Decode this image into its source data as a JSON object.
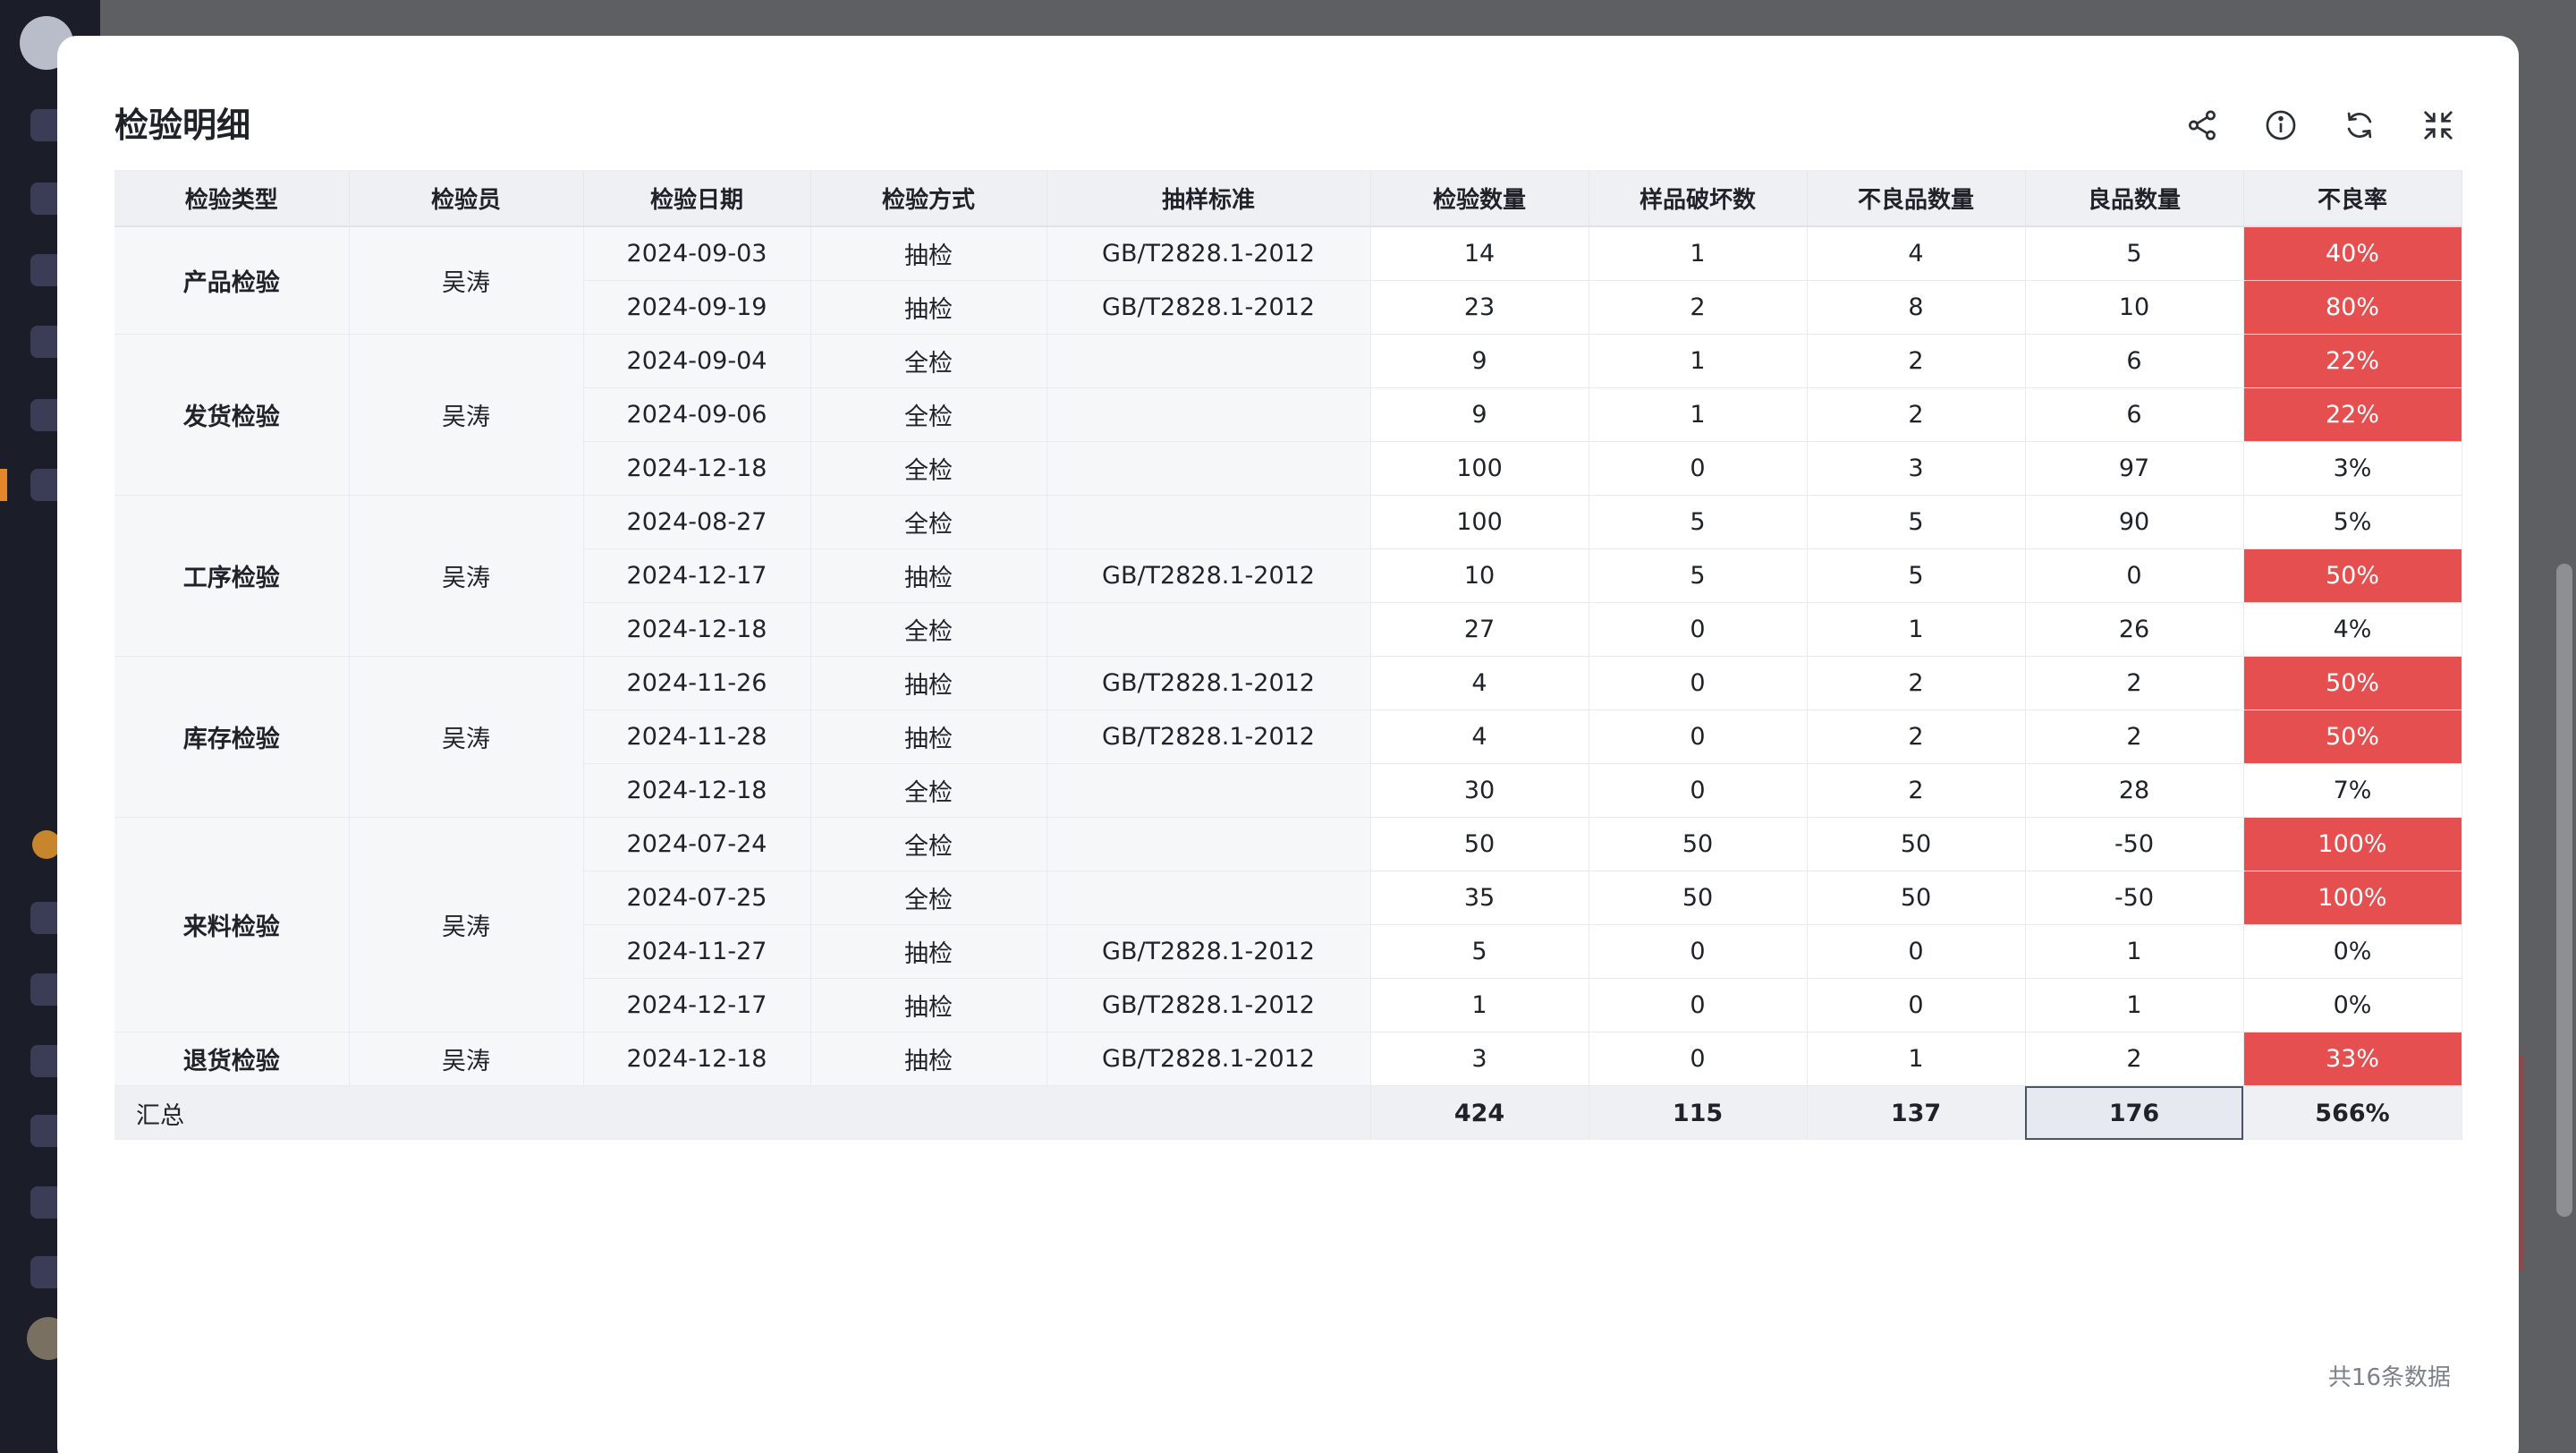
{
  "modal": {
    "title": "检验明细",
    "footer_count": "共16条数据"
  },
  "toolbar": {
    "icons": [
      "share-icon",
      "info-icon",
      "refresh-icon",
      "collapse-icon"
    ]
  },
  "colors": {
    "bad_rate_bg": "#e64f4f",
    "header_bg": "#eef0f4"
  },
  "table": {
    "headers": [
      "检验类型",
      "检验员",
      "检验日期",
      "检验方式",
      "抽样标准",
      "检验数量",
      "样品破坏数",
      "不良品数量",
      "良品数量",
      "不良率"
    ],
    "groups": [
      {
        "type": "产品检验",
        "inspector": "吴涛",
        "rows": [
          {
            "date": "2024-09-03",
            "method": "抽检",
            "standard": "GB/T2828.1-2012",
            "qty": "14",
            "destroyed": "1",
            "defective": "4",
            "good": "5",
            "rate": "40%",
            "bad": true
          },
          {
            "date": "2024-09-19",
            "method": "抽检",
            "standard": "GB/T2828.1-2012",
            "qty": "23",
            "destroyed": "2",
            "defective": "8",
            "good": "10",
            "rate": "80%",
            "bad": true
          }
        ]
      },
      {
        "type": "发货检验",
        "inspector": "吴涛",
        "rows": [
          {
            "date": "2024-09-04",
            "method": "全检",
            "standard": "",
            "qty": "9",
            "destroyed": "1",
            "defective": "2",
            "good": "6",
            "rate": "22%",
            "bad": true
          },
          {
            "date": "2024-09-06",
            "method": "全检",
            "standard": "",
            "qty": "9",
            "destroyed": "1",
            "defective": "2",
            "good": "6",
            "rate": "22%",
            "bad": true
          },
          {
            "date": "2024-12-18",
            "method": "全检",
            "standard": "",
            "qty": "100",
            "destroyed": "0",
            "defective": "3",
            "good": "97",
            "rate": "3%",
            "bad": false
          }
        ]
      },
      {
        "type": "工序检验",
        "inspector": "吴涛",
        "rows": [
          {
            "date": "2024-08-27",
            "method": "全检",
            "standard": "",
            "qty": "100",
            "destroyed": "5",
            "defective": "5",
            "good": "90",
            "rate": "5%",
            "bad": false
          },
          {
            "date": "2024-12-17",
            "method": "抽检",
            "standard": "GB/T2828.1-2012",
            "qty": "10",
            "destroyed": "5",
            "defective": "5",
            "good": "0",
            "rate": "50%",
            "bad": true
          },
          {
            "date": "2024-12-18",
            "method": "全检",
            "standard": "",
            "qty": "27",
            "destroyed": "0",
            "defective": "1",
            "good": "26",
            "rate": "4%",
            "bad": false
          }
        ]
      },
      {
        "type": "库存检验",
        "inspector": "吴涛",
        "rows": [
          {
            "date": "2024-11-26",
            "method": "抽检",
            "standard": "GB/T2828.1-2012",
            "qty": "4",
            "destroyed": "0",
            "defective": "2",
            "good": "2",
            "rate": "50%",
            "bad": true
          },
          {
            "date": "2024-11-28",
            "method": "抽检",
            "standard": "GB/T2828.1-2012",
            "qty": "4",
            "destroyed": "0",
            "defective": "2",
            "good": "2",
            "rate": "50%",
            "bad": true
          },
          {
            "date": "2024-12-18",
            "method": "全检",
            "standard": "",
            "qty": "30",
            "destroyed": "0",
            "defective": "2",
            "good": "28",
            "rate": "7%",
            "bad": false
          }
        ]
      },
      {
        "type": "来料检验",
        "inspector": "吴涛",
        "rows": [
          {
            "date": "2024-07-24",
            "method": "全检",
            "standard": "",
            "qty": "50",
            "destroyed": "50",
            "defective": "50",
            "good": "-50",
            "rate": "100%",
            "bad": true
          },
          {
            "date": "2024-07-25",
            "method": "全检",
            "standard": "",
            "qty": "35",
            "destroyed": "50",
            "defective": "50",
            "good": "-50",
            "rate": "100%",
            "bad": true
          },
          {
            "date": "2024-11-27",
            "method": "抽检",
            "standard": "GB/T2828.1-2012",
            "qty": "5",
            "destroyed": "0",
            "defective": "0",
            "good": "1",
            "rate": "0%",
            "bad": false
          },
          {
            "date": "2024-12-17",
            "method": "抽检",
            "standard": "GB/T2828.1-2012",
            "qty": "1",
            "destroyed": "0",
            "defective": "0",
            "good": "1",
            "rate": "0%",
            "bad": false
          }
        ]
      },
      {
        "type": "退货检验",
        "inspector": "吴涛",
        "rows": [
          {
            "date": "2024-12-18",
            "method": "抽检",
            "standard": "GB/T2828.1-2012",
            "qty": "3",
            "destroyed": "0",
            "defective": "1",
            "good": "2",
            "rate": "33%",
            "bad": true
          }
        ]
      }
    ],
    "summary": {
      "label": "汇总",
      "qty": "424",
      "destroyed": "115",
      "defective": "137",
      "good": "176",
      "rate": "566%"
    }
  }
}
